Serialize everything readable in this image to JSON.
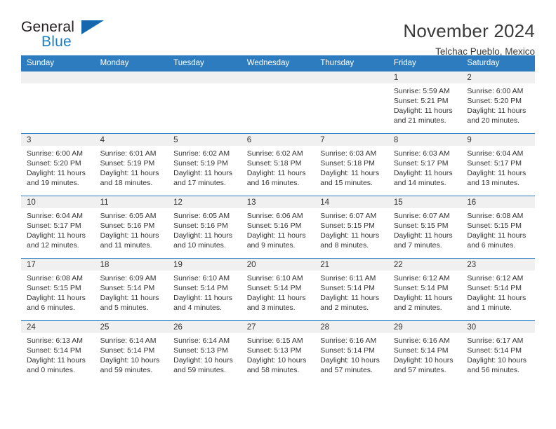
{
  "brand": {
    "name_part1": "General",
    "name_part2": "Blue",
    "triangle_color": "#1667ad",
    "blue_color": "#1b7fc4"
  },
  "header": {
    "title": "November 2024",
    "subtitle": "Telchac Pueblo, Mexico"
  },
  "calendar": {
    "accent_color": "#2e7cc0",
    "daynum_bg": "#f0f0f0",
    "weekday_headers": [
      "Sunday",
      "Monday",
      "Tuesday",
      "Wednesday",
      "Thursday",
      "Friday",
      "Saturday"
    ],
    "weeks": [
      [
        {
          "day": "",
          "empty": true
        },
        {
          "day": "",
          "empty": true
        },
        {
          "day": "",
          "empty": true
        },
        {
          "day": "",
          "empty": true
        },
        {
          "day": "",
          "empty": true
        },
        {
          "day": "1",
          "sunrise": "Sunrise: 5:59 AM",
          "sunset": "Sunset: 5:21 PM",
          "daylight": "Daylight: 11 hours and 21 minutes."
        },
        {
          "day": "2",
          "sunrise": "Sunrise: 6:00 AM",
          "sunset": "Sunset: 5:20 PM",
          "daylight": "Daylight: 11 hours and 20 minutes."
        }
      ],
      [
        {
          "day": "3",
          "sunrise": "Sunrise: 6:00 AM",
          "sunset": "Sunset: 5:20 PM",
          "daylight": "Daylight: 11 hours and 19 minutes."
        },
        {
          "day": "4",
          "sunrise": "Sunrise: 6:01 AM",
          "sunset": "Sunset: 5:19 PM",
          "daylight": "Daylight: 11 hours and 18 minutes."
        },
        {
          "day": "5",
          "sunrise": "Sunrise: 6:02 AM",
          "sunset": "Sunset: 5:19 PM",
          "daylight": "Daylight: 11 hours and 17 minutes."
        },
        {
          "day": "6",
          "sunrise": "Sunrise: 6:02 AM",
          "sunset": "Sunset: 5:18 PM",
          "daylight": "Daylight: 11 hours and 16 minutes."
        },
        {
          "day": "7",
          "sunrise": "Sunrise: 6:03 AM",
          "sunset": "Sunset: 5:18 PM",
          "daylight": "Daylight: 11 hours and 15 minutes."
        },
        {
          "day": "8",
          "sunrise": "Sunrise: 6:03 AM",
          "sunset": "Sunset: 5:17 PM",
          "daylight": "Daylight: 11 hours and 14 minutes."
        },
        {
          "day": "9",
          "sunrise": "Sunrise: 6:04 AM",
          "sunset": "Sunset: 5:17 PM",
          "daylight": "Daylight: 11 hours and 13 minutes."
        }
      ],
      [
        {
          "day": "10",
          "sunrise": "Sunrise: 6:04 AM",
          "sunset": "Sunset: 5:17 PM",
          "daylight": "Daylight: 11 hours and 12 minutes."
        },
        {
          "day": "11",
          "sunrise": "Sunrise: 6:05 AM",
          "sunset": "Sunset: 5:16 PM",
          "daylight": "Daylight: 11 hours and 11 minutes."
        },
        {
          "day": "12",
          "sunrise": "Sunrise: 6:05 AM",
          "sunset": "Sunset: 5:16 PM",
          "daylight": "Daylight: 11 hours and 10 minutes."
        },
        {
          "day": "13",
          "sunrise": "Sunrise: 6:06 AM",
          "sunset": "Sunset: 5:16 PM",
          "daylight": "Daylight: 11 hours and 9 minutes."
        },
        {
          "day": "14",
          "sunrise": "Sunrise: 6:07 AM",
          "sunset": "Sunset: 5:15 PM",
          "daylight": "Daylight: 11 hours and 8 minutes."
        },
        {
          "day": "15",
          "sunrise": "Sunrise: 6:07 AM",
          "sunset": "Sunset: 5:15 PM",
          "daylight": "Daylight: 11 hours and 7 minutes."
        },
        {
          "day": "16",
          "sunrise": "Sunrise: 6:08 AM",
          "sunset": "Sunset: 5:15 PM",
          "daylight": "Daylight: 11 hours and 6 minutes."
        }
      ],
      [
        {
          "day": "17",
          "sunrise": "Sunrise: 6:08 AM",
          "sunset": "Sunset: 5:15 PM",
          "daylight": "Daylight: 11 hours and 6 minutes."
        },
        {
          "day": "18",
          "sunrise": "Sunrise: 6:09 AM",
          "sunset": "Sunset: 5:14 PM",
          "daylight": "Daylight: 11 hours and 5 minutes."
        },
        {
          "day": "19",
          "sunrise": "Sunrise: 6:10 AM",
          "sunset": "Sunset: 5:14 PM",
          "daylight": "Daylight: 11 hours and 4 minutes."
        },
        {
          "day": "20",
          "sunrise": "Sunrise: 6:10 AM",
          "sunset": "Sunset: 5:14 PM",
          "daylight": "Daylight: 11 hours and 3 minutes."
        },
        {
          "day": "21",
          "sunrise": "Sunrise: 6:11 AM",
          "sunset": "Sunset: 5:14 PM",
          "daylight": "Daylight: 11 hours and 2 minutes."
        },
        {
          "day": "22",
          "sunrise": "Sunrise: 6:12 AM",
          "sunset": "Sunset: 5:14 PM",
          "daylight": "Daylight: 11 hours and 2 minutes."
        },
        {
          "day": "23",
          "sunrise": "Sunrise: 6:12 AM",
          "sunset": "Sunset: 5:14 PM",
          "daylight": "Daylight: 11 hours and 1 minute."
        }
      ],
      [
        {
          "day": "24",
          "sunrise": "Sunrise: 6:13 AM",
          "sunset": "Sunset: 5:14 PM",
          "daylight": "Daylight: 11 hours and 0 minutes."
        },
        {
          "day": "25",
          "sunrise": "Sunrise: 6:14 AM",
          "sunset": "Sunset: 5:14 PM",
          "daylight": "Daylight: 10 hours and 59 minutes."
        },
        {
          "day": "26",
          "sunrise": "Sunrise: 6:14 AM",
          "sunset": "Sunset: 5:13 PM",
          "daylight": "Daylight: 10 hours and 59 minutes."
        },
        {
          "day": "27",
          "sunrise": "Sunrise: 6:15 AM",
          "sunset": "Sunset: 5:13 PM",
          "daylight": "Daylight: 10 hours and 58 minutes."
        },
        {
          "day": "28",
          "sunrise": "Sunrise: 6:16 AM",
          "sunset": "Sunset: 5:14 PM",
          "daylight": "Daylight: 10 hours and 57 minutes."
        },
        {
          "day": "29",
          "sunrise": "Sunrise: 6:16 AM",
          "sunset": "Sunset: 5:14 PM",
          "daylight": "Daylight: 10 hours and 57 minutes."
        },
        {
          "day": "30",
          "sunrise": "Sunrise: 6:17 AM",
          "sunset": "Sunset: 5:14 PM",
          "daylight": "Daylight: 10 hours and 56 minutes."
        }
      ]
    ]
  }
}
